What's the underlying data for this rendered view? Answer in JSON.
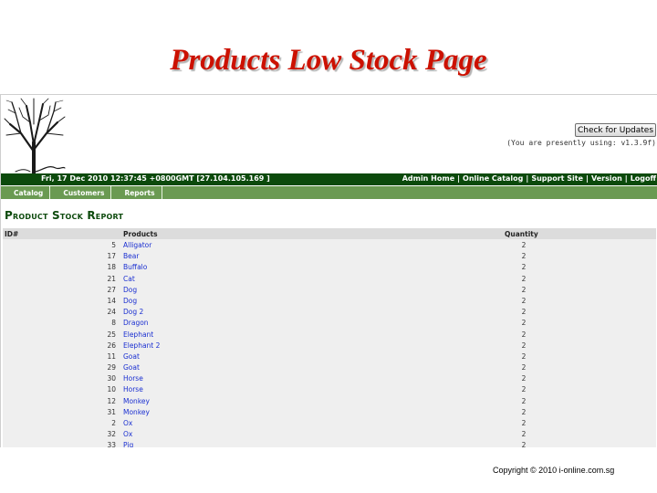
{
  "slide": {
    "title": "Products Low Stock Page"
  },
  "app": {
    "update_button": "Check for Updates",
    "version_note": "(You are presently using: v1.3.9f)",
    "datetime": "Fri, 17 Dec 2010 12:37:45 +0800GMT [27.104.105.169 ]",
    "top_links": [
      "Admin Home",
      "Online Catalog",
      "Support Site",
      "Version",
      "Logoff"
    ],
    "menu": [
      "Catalog",
      "Customers",
      "Reports"
    ],
    "report_title": "Product Stock Report",
    "columns": {
      "id": "ID#",
      "product": "Products",
      "quantity": "Quantity"
    },
    "rows": [
      {
        "id": "5",
        "product": "Alligator",
        "qty": "2"
      },
      {
        "id": "17",
        "product": "Bear",
        "qty": "2"
      },
      {
        "id": "18",
        "product": "Buffalo",
        "qty": "2"
      },
      {
        "id": "21",
        "product": "Cat",
        "qty": "2"
      },
      {
        "id": "27",
        "product": "Dog",
        "qty": "2"
      },
      {
        "id": "14",
        "product": "Dog",
        "qty": "2"
      },
      {
        "id": "24",
        "product": "Dog 2",
        "qty": "2"
      },
      {
        "id": "8",
        "product": "Dragon",
        "qty": "2"
      },
      {
        "id": "25",
        "product": "Elephant",
        "qty": "2"
      },
      {
        "id": "26",
        "product": "Elephant 2",
        "qty": "2"
      },
      {
        "id": "11",
        "product": "Goat",
        "qty": "2"
      },
      {
        "id": "29",
        "product": "Goat",
        "qty": "2"
      },
      {
        "id": "30",
        "product": "Horse",
        "qty": "2"
      },
      {
        "id": "10",
        "product": "Horse",
        "qty": "2"
      },
      {
        "id": "12",
        "product": "Monkey",
        "qty": "2"
      },
      {
        "id": "31",
        "product": "Monkey",
        "qty": "2"
      },
      {
        "id": "2",
        "product": "Ox",
        "qty": "2"
      },
      {
        "id": "32",
        "product": "Ox",
        "qty": "2"
      },
      {
        "id": "33",
        "product": "Pig",
        "qty": "2"
      }
    ]
  },
  "footer": {
    "copyright": "Copyright © 2010  i-online.com.sg"
  },
  "colors": {
    "title": "#cc1100",
    "topbar": "#0c4a0c",
    "menubar": "#6a9a52",
    "link": "#1a2fd1"
  },
  "icons": {
    "logo": "tree-logo"
  }
}
